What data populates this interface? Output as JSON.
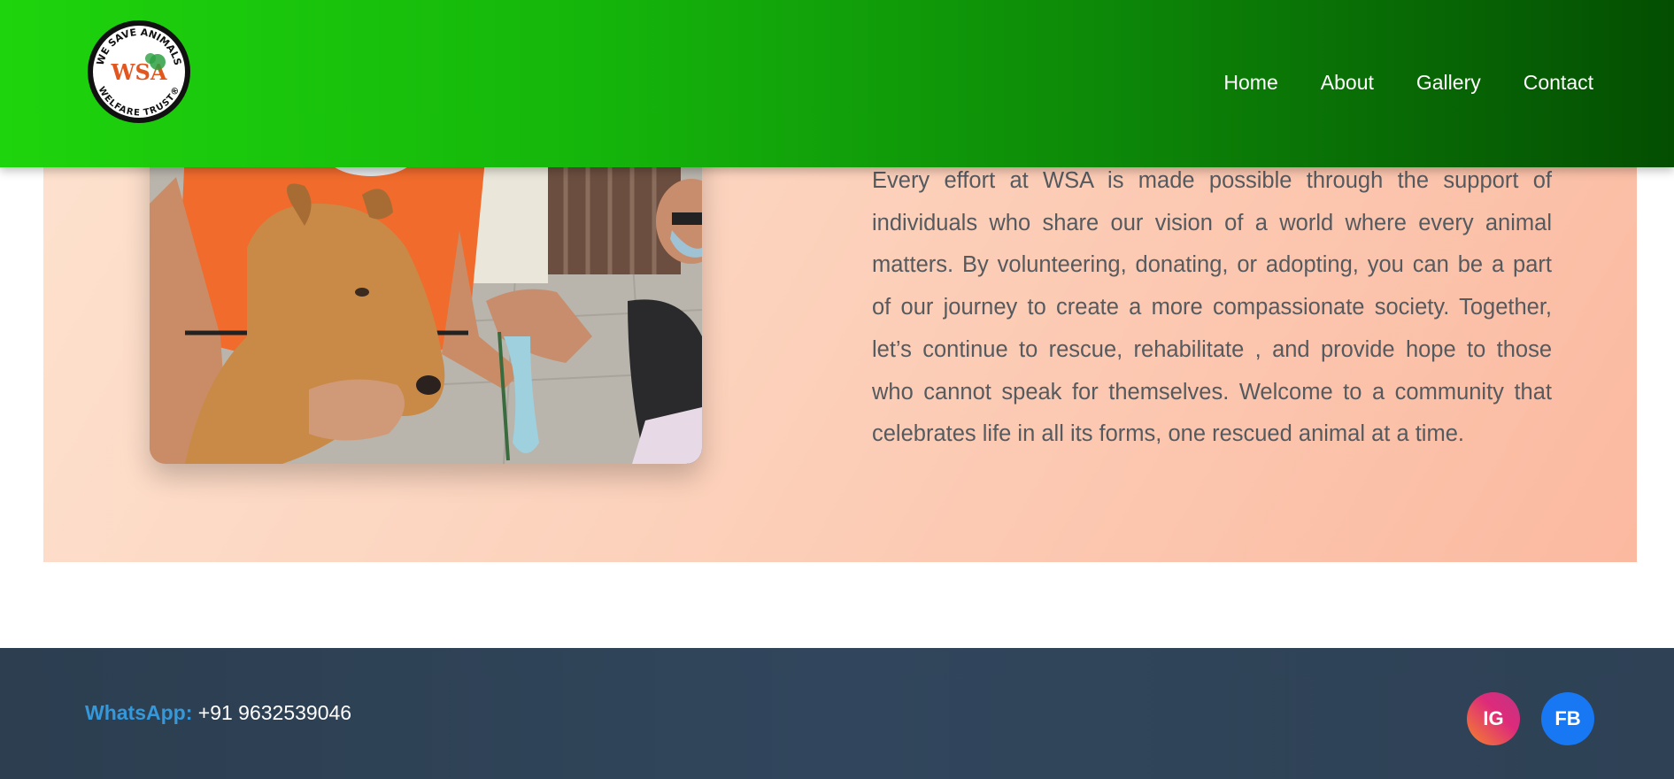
{
  "header": {
    "logo": {
      "icon": "wsa-logo-icon",
      "top_text": "WE SAVE ANIMALS",
      "center_text": "WSA",
      "bottom_text": "WELFARE TRUST®"
    },
    "nav": [
      {
        "label": "Home"
      },
      {
        "label": "About"
      },
      {
        "label": "Gallery"
      },
      {
        "label": "Contact"
      }
    ]
  },
  "about": {
    "image": {
      "subject": "rescued-dog-photo"
    },
    "paragraph": "Every effort at WSA is made possible through the support of individuals who share our vision of a world where every animal matters. By volunteering, donating, or adopting, you can be a part of our journey to create a more compassionate society. Together, let’s continue to rescue, rehabilitate , and provide hope to those who cannot speak for themselves. Welcome to a community that celebrates life in all its forms, one rescued animal at a time."
  },
  "footer": {
    "whatsapp_label": "WhatsApp:",
    "whatsapp_number": "+91 9632539046",
    "social": [
      {
        "label": "IG",
        "icon": "instagram-icon"
      },
      {
        "label": "FB",
        "icon": "facebook-icon"
      }
    ]
  },
  "colors": {
    "header_start": "#1ed40c",
    "header_end": "#044e02",
    "section_bg": "#fcd2bc",
    "footer_bg": "#2c3e50",
    "whatsapp_accent": "#3498db",
    "facebook": "#1877f2"
  }
}
